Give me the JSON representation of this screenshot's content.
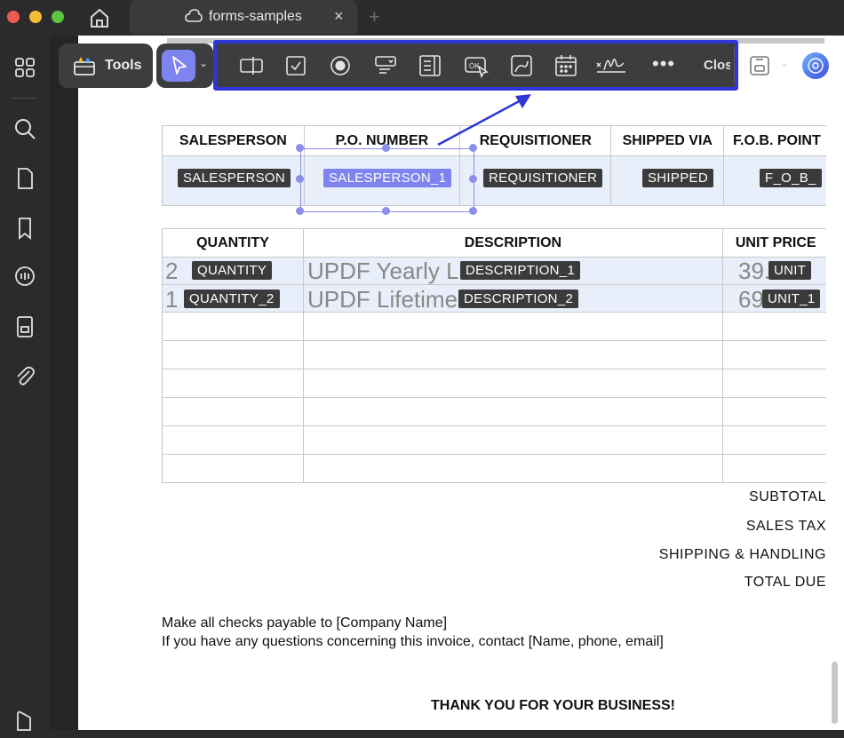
{
  "window": {
    "tab_title": "forms-samples",
    "tab_close": "×",
    "tab_add": "+"
  },
  "toolbar": {
    "tools_label": "Tools",
    "close_label": "Close",
    "more_label": "•••",
    "select_caret": "⌄",
    "save_caret": "⌄",
    "form_tools": [
      "text-field-icon",
      "checkbox-icon",
      "radio-button-icon",
      "dropdown-icon",
      "list-box-icon",
      "button-icon",
      "image-field-icon",
      "date-field-icon",
      "signature-icon"
    ]
  },
  "sidebar": {
    "items": [
      "apps-icon",
      "search-icon",
      "page-icon",
      "bookmark-icon",
      "comment-icon",
      "organize-icon",
      "attachment-icon",
      "layers-icon"
    ]
  },
  "document": {
    "order_table": {
      "headers": [
        "SALESPERSON",
        "P.O. NUMBER",
        "REQUISITIONER",
        "SHIPPED VIA",
        "F.O.B. POINT"
      ],
      "fields": [
        "SALESPERSON",
        "SALESPERSON_1",
        "REQUISITIONER",
        "SHIPPED",
        "F_O_B_"
      ],
      "selected_field": "SALESPERSON_1"
    },
    "items_table": {
      "headers": [
        "QUANTITY",
        "DESCRIPTION",
        "UNIT PRICE"
      ],
      "rows": [
        {
          "qty": "2",
          "qty_field": "QUANTITY",
          "desc": "UPDF Yearly L",
          "desc_field": "DESCRIPTION_1",
          "price": "39.",
          "price_field": "UNIT"
        },
        {
          "qty": "1",
          "qty_field": "QUANTITY_2",
          "desc": "UPDF Lifetime",
          "desc_field": "DESCRIPTION_2",
          "price": "69",
          "price_field": "UNIT_1"
        }
      ]
    },
    "totals": [
      "SUBTOTAL",
      "SALES TAX",
      "SHIPPING & HANDLING",
      "TOTAL DUE"
    ],
    "note_line_1": "Make all checks payable to [Company Name]",
    "note_line_2": "If you have any questions concerning this invoice, contact [Name, phone, email]",
    "thanks": "THANK YOU FOR YOUR BUSINESS!"
  },
  "colors": {
    "highlight_border": "#2f36d8",
    "selection": "#7e84ef",
    "field_tag": "#3b3b3b"
  }
}
